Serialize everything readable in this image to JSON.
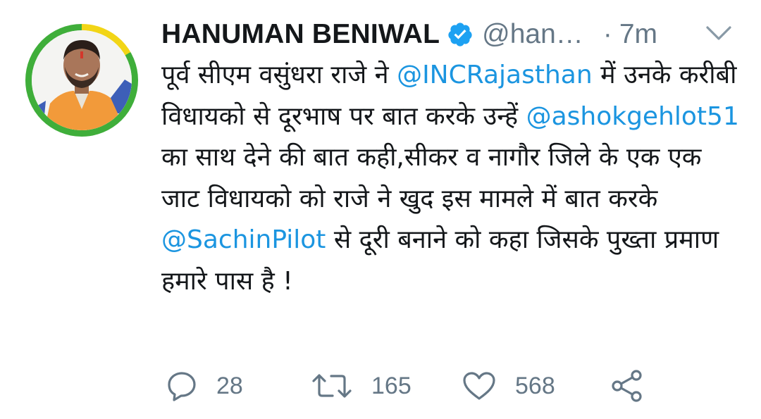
{
  "tweet": {
    "author": {
      "name": "HANUMAN BENIWAL",
      "handle": "@han…",
      "verified": true
    },
    "separator": "·",
    "time": "7m",
    "text_parts": [
      "पूर्व सीएम वसुंधरा राजे ने ",
      "@INCRajasthan",
      " में उनके करीबी विधायको से दूरभाष पर बात करके उन्हें ",
      "@ashokgehlot51",
      " का साथ देने की बात कही,सीकर व नागौर जिले के एक एक जाट विधायको को राजे ने खुद इस मामले में बात करके ",
      "@SachinPilot",
      " से दूरी बनाने को कहा जिसके पुख्ता प्रमाण हमारे पास है !"
    ]
  },
  "actions": {
    "replies": "28",
    "retweets": "165",
    "likes": "568"
  },
  "icons": {
    "verified": "verified-badge-icon",
    "menu": "chevron-down-icon",
    "reply": "reply-icon",
    "retweet": "retweet-icon",
    "like": "heart-icon",
    "share": "share-icon"
  },
  "colors": {
    "link": "#1b95e0",
    "secondary_text": "#657786",
    "primary_text": "#14171a",
    "avatar_ring_yellow": "#f2d516",
    "avatar_ring_green": "#3fae3a"
  }
}
